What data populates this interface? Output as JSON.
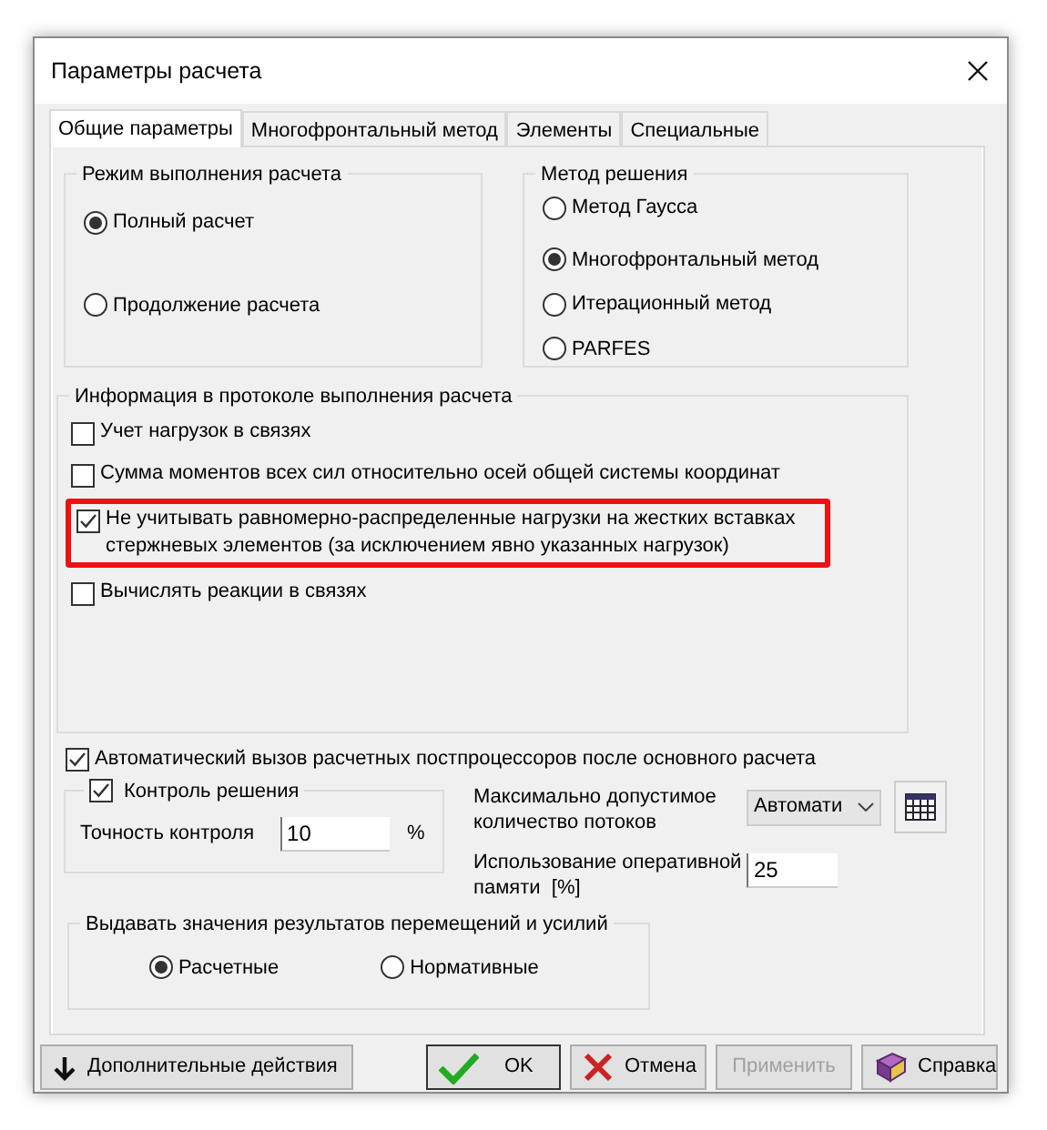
{
  "window": {
    "title": "Параметры расчета"
  },
  "tabs": [
    {
      "label": "Общие параметры",
      "selected": true
    },
    {
      "label": "Многофронтальный метод",
      "selected": false
    },
    {
      "label": "Элементы",
      "selected": false
    },
    {
      "label": "Специальные",
      "selected": false
    }
  ],
  "mode_group": {
    "title": "Режим выполнения расчета",
    "options": [
      {
        "label": "Полный расчет",
        "selected": true
      },
      {
        "label": "Продолжение расчета",
        "selected": false
      }
    ]
  },
  "method_group": {
    "title": "Метод решения",
    "options": [
      {
        "label": "Метод Гаусса",
        "selected": false
      },
      {
        "label": "Многофронтальный метод",
        "selected": true
      },
      {
        "label": "Итерационный метод",
        "selected": false
      },
      {
        "label": "PARFES",
        "selected": false
      }
    ]
  },
  "protocol_group": {
    "title": "Информация в протоколе выполнения расчета",
    "items": [
      {
        "label": "Учет нагрузок в связях",
        "checked": false,
        "highlighted": false
      },
      {
        "label": "Сумма моментов всех сил относительно осей общей системы координат",
        "checked": false,
        "highlighted": false
      },
      {
        "label": "Не учитывать равномерно-распределенные нагрузки на жестких вставках стержневых элементов (за исключением явно указанных нагрузок)",
        "checked": true,
        "highlighted": true
      },
      {
        "label": "Вычислять реакции в связях",
        "checked": false,
        "highlighted": false
      }
    ]
  },
  "auto_postprocessors": {
    "label": "Автоматический вызов расчетных постпроцессоров после основного расчета",
    "checked": true
  },
  "control_group": {
    "label": "Контроль решения",
    "checked": true,
    "accuracy_label": "Точность контроля",
    "accuracy_value": "10",
    "unit": "%"
  },
  "threads": {
    "label": "Максимально допустимое количество потоков",
    "value": "Автомати"
  },
  "memory": {
    "label": "Использование оперативной памяти  [%]",
    "value": "25"
  },
  "output_group": {
    "title": "Выдавать значения результатов перемещений и усилий",
    "options": [
      {
        "label": "Расчетные",
        "selected": true
      },
      {
        "label": "Нормативные",
        "selected": false
      }
    ]
  },
  "buttons": [
    {
      "label": "Дополнительные действия",
      "kind": "more",
      "disabled": false
    },
    {
      "label": "OK",
      "kind": "ok",
      "disabled": false
    },
    {
      "label": "Отмена",
      "kind": "cancel",
      "disabled": false
    },
    {
      "label": "Применить",
      "kind": "apply",
      "disabled": true
    },
    {
      "label": "Справка",
      "kind": "help",
      "disabled": false
    }
  ]
}
